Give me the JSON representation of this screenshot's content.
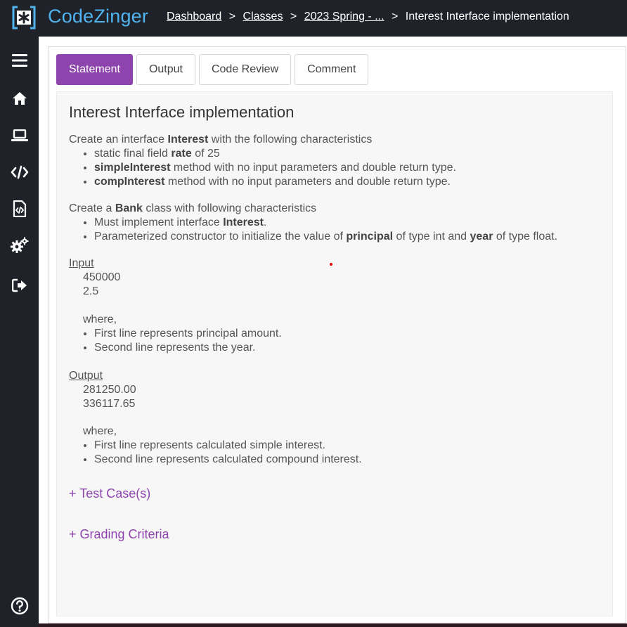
{
  "app": {
    "brand": "CodeZinger"
  },
  "breadcrumb": {
    "items": [
      "Dashboard",
      "Classes",
      "2023 Spring - ..."
    ],
    "separator": ">",
    "current": "Interest Interface implementation"
  },
  "sidebar": {
    "icons": [
      "menu-icon",
      "home-icon",
      "laptop-icon",
      "code-icon",
      "code-file-icon",
      "settings-icon",
      "logout-icon",
      "help-icon"
    ]
  },
  "tabs": [
    "Statement",
    "Output",
    "Code Review",
    "Comment"
  ],
  "statement": {
    "title": "Interest Interface implementation",
    "intro1": {
      "pre": "Create an interface ",
      "bold": "Interest",
      "post": " with the following characteristics"
    },
    "list1": [
      {
        "pre": "static final field ",
        "bold": "rate",
        "post": " of 25"
      },
      {
        "pre": "",
        "bold": "simpleInterest",
        "post": " method with no input parameters and double return type."
      },
      {
        "pre": "",
        "bold": "compInterest",
        "post": " method with no input parameters and double return type."
      }
    ],
    "intro2": {
      "pre": "Create a ",
      "bold": "Bank",
      "post": " class with following characteristics"
    },
    "list2a": {
      "pre": "Must implement interface ",
      "bold": "Interest",
      "post": "."
    },
    "list2b": {
      "pre": "Parameterized constructor to initialize the value of ",
      "bold1": "principal",
      "mid": " of type int and ",
      "bold2": "year",
      "post": " of type float."
    },
    "input": {
      "heading": "Input",
      "lines": [
        "450000",
        "2.5"
      ],
      "where": "where,",
      "notes": [
        "First line represents principal amount.",
        "Second line represents the year."
      ]
    },
    "output": {
      "heading": "Output",
      "lines": [
        "281250.00",
        "336117.65"
      ],
      "where": "where,",
      "notes": [
        "First line represents calculated simple interest.",
        "Second line represents calculated compound interest."
      ]
    },
    "test_cases": "+ Test Case(s)",
    "grading": "+ Grading Criteria"
  },
  "colors": {
    "accent": "#8e44ad",
    "brand": "#4fb4f0",
    "sidebar_bg": "#1f2229"
  }
}
